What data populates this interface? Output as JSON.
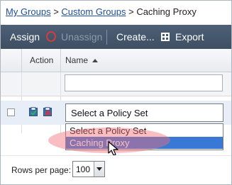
{
  "breadcrumb": {
    "items": [
      "My Groups",
      "Custom Groups",
      "Caching Proxy"
    ],
    "separator": ">"
  },
  "toolbar": {
    "assign_label": "Assign",
    "unassign_label": "Unassign",
    "create_label": "Create...",
    "export_label": "Export"
  },
  "table": {
    "headers": {
      "action": "Action",
      "name": "Name"
    },
    "sort": "ascending",
    "filter_value": "",
    "row": {
      "checked": false,
      "policy_select_value": "Select a Policy Set"
    }
  },
  "dropdown": {
    "options": [
      "Select a Policy Set",
      "Caching Proxy"
    ],
    "highlighted": "Caching Proxy"
  },
  "pager": {
    "rows_per_page_label": "Rows per page:",
    "rows_per_page_value": "100"
  },
  "colors": {
    "toolbar_bg": "#45576d",
    "link": "#1b4fa0",
    "selected_option": "#3a78d6",
    "annotation_highlight": "#f06e78",
    "row_bg": "#e7eef7"
  }
}
